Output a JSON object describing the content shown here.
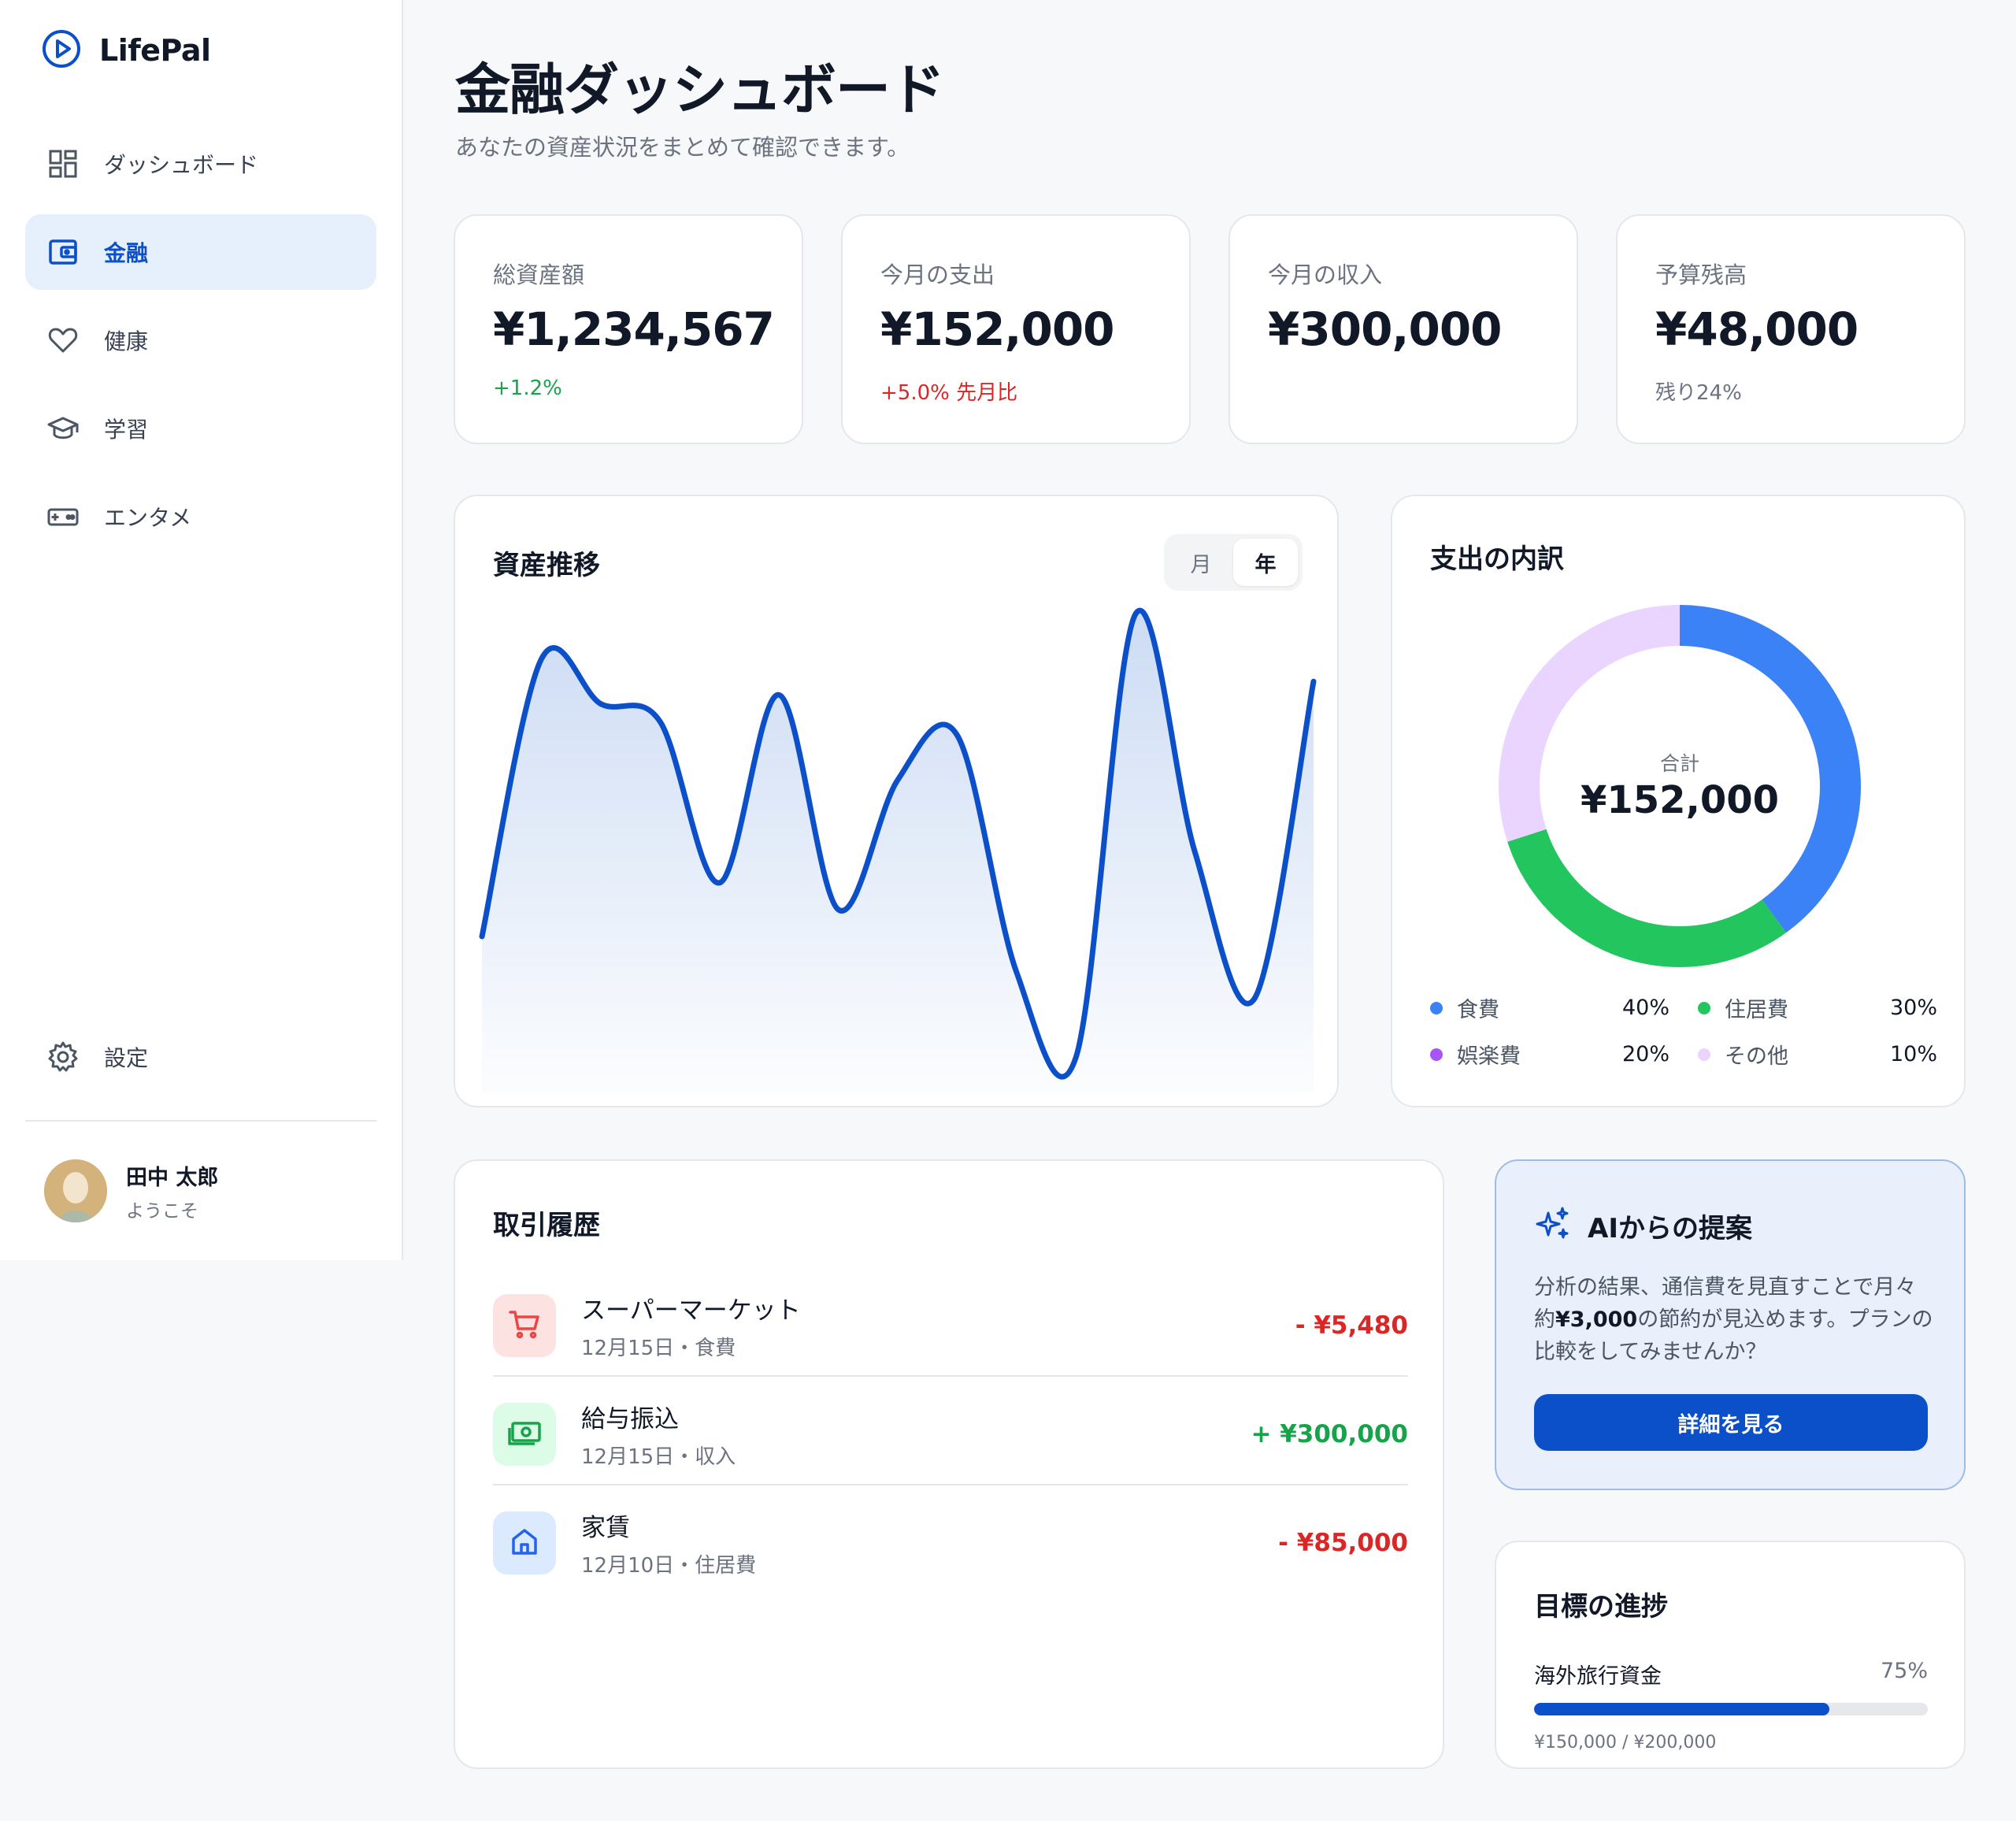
{
  "app": {
    "name": "LifePal"
  },
  "sidebar": {
    "items": [
      {
        "label": "ダッシュボード",
        "icon": "dashboard-icon"
      },
      {
        "label": "金融",
        "icon": "wallet-icon",
        "active": true
      },
      {
        "label": "健康",
        "icon": "heart-icon"
      },
      {
        "label": "学習",
        "icon": "graduation-cap-icon"
      },
      {
        "label": "エンタメ",
        "icon": "gamepad-icon"
      }
    ],
    "settings_label": "設定",
    "user": {
      "name": "田中 太郎",
      "subtitle": "ようこそ"
    }
  },
  "header": {
    "title": "金融ダッシュボード",
    "subtitle": "あなたの資産状況をまとめて確認できます。"
  },
  "stats": [
    {
      "label": "総資産額",
      "value": "¥1,234,567",
      "note": "+1.2%",
      "note_color": "#16a34a"
    },
    {
      "label": "今月の支出",
      "value": "¥152,000",
      "note": "+5.0% 先月比",
      "note_color": "#dc2626"
    },
    {
      "label": "今月の収入",
      "value": "¥300,000",
      "note": "",
      "note_color": "#6b7280"
    },
    {
      "label": "予算残高",
      "value": "¥48,000",
      "note": "残り24%",
      "note_color": "#6b7280"
    }
  ],
  "asset_chart": {
    "title": "資産推移",
    "toggle": [
      "月",
      "年"
    ],
    "toggle_selected": "年"
  },
  "breakdown": {
    "title": "支出の内訳",
    "center_label": "合計",
    "center_value": "¥152,000"
  },
  "chart_data": [
    {
      "type": "area",
      "title": "資産推移",
      "xlabel": "",
      "ylabel": "",
      "x": [
        0,
        1,
        2,
        3,
        4,
        5,
        6,
        7,
        8,
        9,
        10,
        11,
        12,
        13,
        14,
        15,
        16,
        17,
        18,
        19,
        20,
        21,
        22,
        23,
        24
      ],
      "values": [
        28,
        90,
        80,
        76,
        40,
        82,
        34,
        63,
        73,
        20,
        1,
        100,
        47,
        14,
        85
      ],
      "grid": false,
      "ylim": [
        0,
        100
      ],
      "color": "#0b4fc9"
    },
    {
      "type": "pie",
      "title": "支出の内訳",
      "donut": true,
      "categories": [
        "食費",
        "住居費",
        "娯楽費",
        "その他"
      ],
      "values": [
        40,
        30,
        20,
        10
      ],
      "value_labels": [
        "40%",
        "30%",
        "20%",
        "10%"
      ],
      "colors": [
        "#3b82f6",
        "#22c55e",
        "#a855f7",
        "#e9d5ff"
      ],
      "legend": "bottom"
    }
  ],
  "transactions": {
    "title": "取引履歴",
    "rows": [
      {
        "name": "スーパーマーケット",
        "meta": "12月15日・食費",
        "amount": "- ¥5,480",
        "icon": "shopping-cart-icon",
        "amount_color": "#dc2626",
        "icon_bg": "#fde2e2",
        "icon_color": "#ef4444"
      },
      {
        "name": "給与振込",
        "meta": "12月15日・収入",
        "amount": "+ ¥300,000",
        "icon": "cash-icon",
        "amount_color": "#16a34a",
        "icon_bg": "#dcfce7",
        "icon_color": "#16a34a"
      },
      {
        "name": "家賃",
        "meta": "12月10日・住居費",
        "amount": "- ¥85,000",
        "icon": "home-icon",
        "amount_color": "#dc2626",
        "icon_bg": "#dbeafe",
        "icon_color": "#2563eb"
      }
    ]
  },
  "ai_suggestion": {
    "title": "AIからの提案",
    "body_before": "分析の結果、通信費を見直すことで月々約",
    "body_bold": "¥3,000",
    "body_after": "の節約が見込めます。プランの比較をしてみませんか？",
    "button_label": "詳細を見る",
    "icon": "sparkles-icon"
  },
  "goals": {
    "title": "目標の進捗",
    "items": [
      {
        "name": "海外旅行資金",
        "percent_label": "75%",
        "progress": 0.75,
        "amount": "¥150,000 / ¥200,000"
      }
    ]
  },
  "colors": {
    "accent": "#0b4fc9",
    "positive": "#16a34a",
    "negative": "#dc2626"
  }
}
